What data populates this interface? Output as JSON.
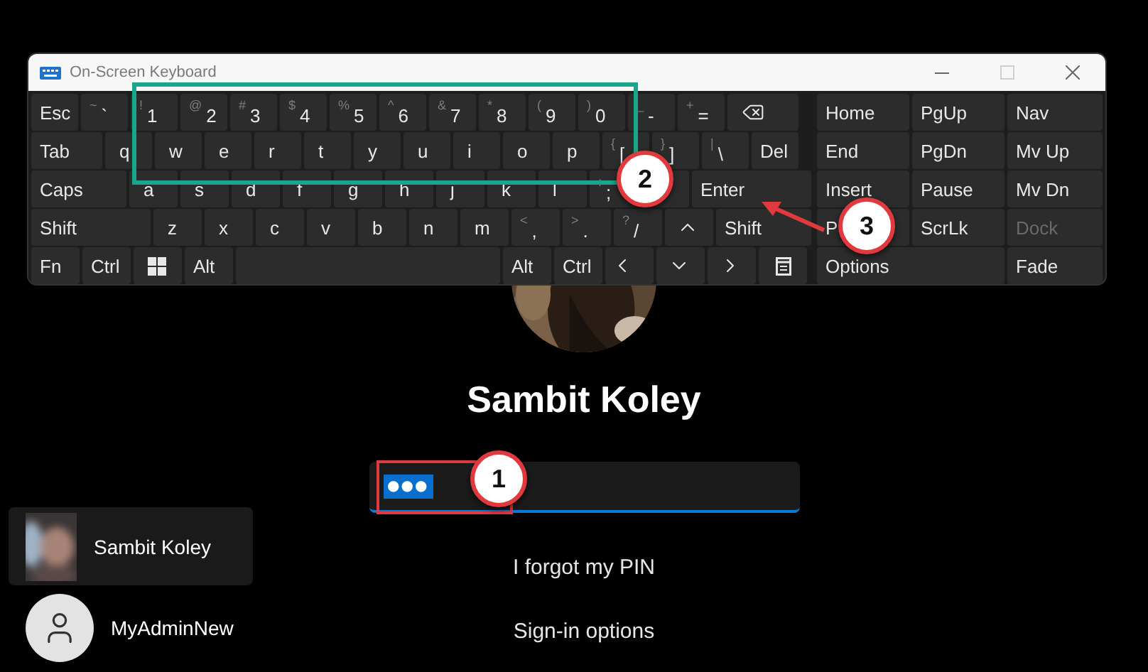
{
  "window": {
    "title": "On-Screen Keyboard",
    "controls": [
      {
        "kind": "minimize",
        "disabled": false
      },
      {
        "kind": "maximize",
        "disabled": true
      },
      {
        "kind": "close",
        "disabled": false
      }
    ]
  },
  "keyboard": {
    "rows": [
      [
        {
          "kind": "text",
          "label": "Esc"
        },
        {
          "kind": "text",
          "label": "`",
          "shift": "~"
        },
        {
          "kind": "text",
          "label": "1",
          "shift": "!"
        },
        {
          "kind": "text",
          "label": "2",
          "shift": "@"
        },
        {
          "kind": "text",
          "label": "3",
          "shift": "#"
        },
        {
          "kind": "text",
          "label": "4",
          "shift": "$"
        },
        {
          "kind": "text",
          "label": "5",
          "shift": "%"
        },
        {
          "kind": "text",
          "label": "6",
          "shift": "^"
        },
        {
          "kind": "text",
          "label": "7",
          "shift": "&"
        },
        {
          "kind": "text",
          "label": "8",
          "shift": "*"
        },
        {
          "kind": "text",
          "label": "9",
          "shift": "("
        },
        {
          "kind": "text",
          "label": "0",
          "shift": ")"
        },
        {
          "kind": "text",
          "label": "-",
          "shift": "_"
        },
        {
          "kind": "text",
          "label": "=",
          "shift": "+"
        },
        {
          "kind": "backspace"
        }
      ],
      [
        {
          "kind": "text",
          "label": "Tab"
        },
        {
          "kind": "text",
          "label": "q"
        },
        {
          "kind": "text",
          "label": "w"
        },
        {
          "kind": "text",
          "label": "e"
        },
        {
          "kind": "text",
          "label": "r"
        },
        {
          "kind": "text",
          "label": "t"
        },
        {
          "kind": "text",
          "label": "y"
        },
        {
          "kind": "text",
          "label": "u"
        },
        {
          "kind": "text",
          "label": "i"
        },
        {
          "kind": "text",
          "label": "o"
        },
        {
          "kind": "text",
          "label": "p"
        },
        {
          "kind": "text",
          "label": "[",
          "shift": "{"
        },
        {
          "kind": "text",
          "label": "]",
          "shift": "}"
        },
        {
          "kind": "text",
          "label": "\\",
          "shift": "|"
        },
        {
          "kind": "text",
          "label": "Del"
        }
      ],
      [
        {
          "kind": "text",
          "label": "Caps"
        },
        {
          "kind": "text",
          "label": "a"
        },
        {
          "kind": "text",
          "label": "s"
        },
        {
          "kind": "text",
          "label": "d"
        },
        {
          "kind": "text",
          "label": "f"
        },
        {
          "kind": "text",
          "label": "g"
        },
        {
          "kind": "text",
          "label": "h"
        },
        {
          "kind": "text",
          "label": "j"
        },
        {
          "kind": "text",
          "label": "k"
        },
        {
          "kind": "text",
          "label": "l"
        },
        {
          "kind": "text",
          "label": ";",
          "shift": ":"
        },
        {
          "kind": "blank"
        },
        {
          "kind": "text",
          "label": "Enter"
        }
      ],
      [
        {
          "kind": "text",
          "label": "Shift"
        },
        {
          "kind": "text",
          "label": "z"
        },
        {
          "kind": "text",
          "label": "x"
        },
        {
          "kind": "text",
          "label": "c"
        },
        {
          "kind": "text",
          "label": "v"
        },
        {
          "kind": "text",
          "label": "b"
        },
        {
          "kind": "text",
          "label": "n"
        },
        {
          "kind": "text",
          "label": "m"
        },
        {
          "kind": "text",
          "label": ",",
          "shift": "<"
        },
        {
          "kind": "text",
          "label": ".",
          "shift": ">"
        },
        {
          "kind": "text",
          "label": "/",
          "shift": "?"
        },
        {
          "kind": "up"
        },
        {
          "kind": "text",
          "label": "Shift"
        }
      ],
      [
        {
          "kind": "text",
          "label": "Fn"
        },
        {
          "kind": "text",
          "label": "Ctrl"
        },
        {
          "kind": "windows"
        },
        {
          "kind": "text",
          "label": "Alt"
        },
        {
          "kind": "blank"
        },
        {
          "kind": "text",
          "label": "Alt"
        },
        {
          "kind": "text",
          "label": "Ctrl"
        },
        {
          "kind": "left"
        },
        {
          "kind": "down"
        },
        {
          "kind": "right"
        },
        {
          "kind": "menu"
        }
      ]
    ],
    "side_keys": [
      {
        "kind": "key",
        "label": "Home",
        "disabled": false
      },
      {
        "kind": "key",
        "label": "PgUp",
        "disabled": false
      },
      {
        "kind": "key",
        "label": "Nav",
        "disabled": false
      },
      {
        "kind": "key",
        "label": "End",
        "disabled": false
      },
      {
        "kind": "key",
        "label": "PgDn",
        "disabled": false
      },
      {
        "kind": "key",
        "label": "Mv Up",
        "disabled": false
      },
      {
        "kind": "key",
        "label": "Insert",
        "disabled": false
      },
      {
        "kind": "key",
        "label": "Pause",
        "disabled": false
      },
      {
        "kind": "key",
        "label": "Mv Dn",
        "disabled": false
      },
      {
        "kind": "key",
        "label": "P",
        "disabled": false
      },
      {
        "kind": "key",
        "label": "ScrLk",
        "disabled": false
      },
      {
        "kind": "key",
        "label": "Dock",
        "disabled": true
      },
      {
        "kind": "wide",
        "label": "Options",
        "disabled": false
      },
      {
        "kind": "key",
        "label": "Fade",
        "disabled": false
      }
    ]
  },
  "sign_in": {
    "user_name": "Sambit Koley",
    "pin_field": {
      "value": "●●●",
      "selected": true
    },
    "forgot_link": "I forgot my PIN",
    "options_link": "Sign-in options"
  },
  "users": [
    {
      "name": "Sambit Koley",
      "kind": "picture",
      "selected": true
    },
    {
      "name": "MyAdminNew",
      "kind": "default",
      "selected": false
    }
  ],
  "annotations": [
    {
      "label": "1"
    },
    {
      "label": "2"
    },
    {
      "label": "3"
    }
  ]
}
